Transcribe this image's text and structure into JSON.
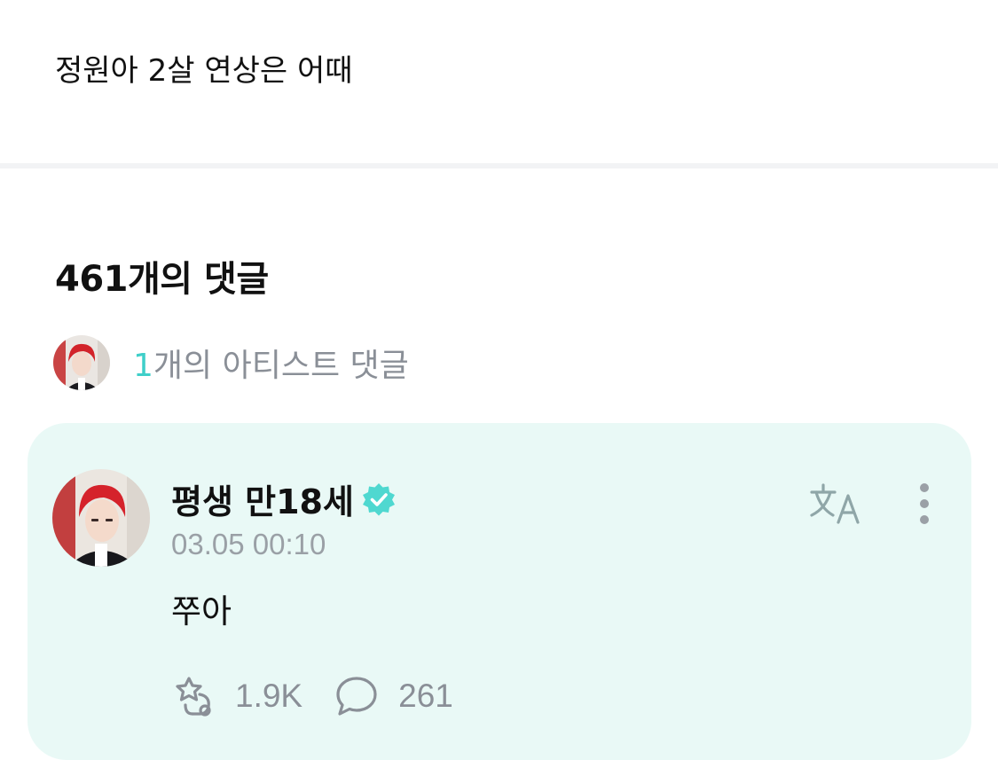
{
  "post": {
    "text": "정원아 2살 연상은 어때"
  },
  "comments": {
    "heading": "461개의 댓글",
    "artist_summary": {
      "count": "1",
      "label": "개의 아티스트 댓글"
    }
  },
  "comment": {
    "author": "평생 만18세",
    "timestamp": "03.05 00:10",
    "body": "쭈아",
    "likes": "1.9K",
    "replies": "261"
  },
  "colors": {
    "accent": "#3fcfc9",
    "card_background": "#e9f9f6",
    "muted_text": "#8a8f97"
  },
  "icons": [
    "verified-badge-icon",
    "translate-icon",
    "more-vertical-icon",
    "cheer-icon",
    "comment-bubble-icon"
  ]
}
